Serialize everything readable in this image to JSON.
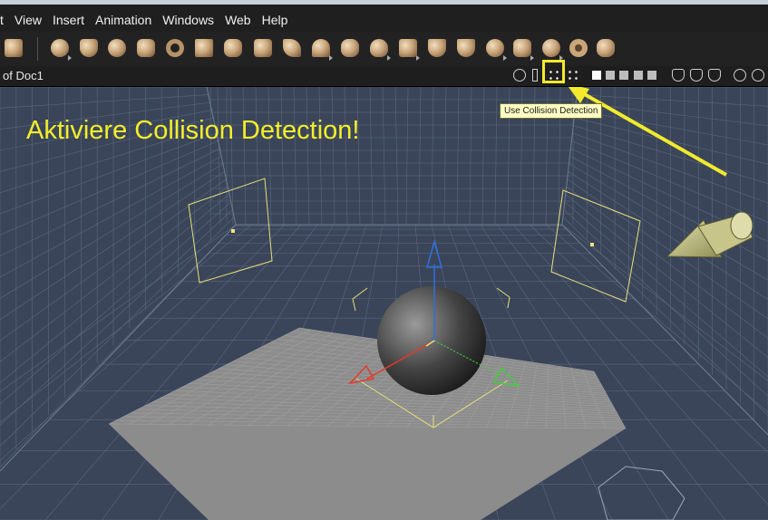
{
  "menubar": {
    "items": [
      "t",
      "View",
      "Insert",
      "Animation",
      "Windows",
      "Web",
      "Help"
    ]
  },
  "toolbar": {
    "icons": [
      "prop-hand-icon",
      "sphere-icon",
      "goblet-icon",
      "globe-icon",
      "figure-icon",
      "torus-icon",
      "text-icon",
      "gem-icon",
      "flower-icon",
      "terrain-icon",
      "tree-icon",
      "cloud-icon",
      "fire-icon",
      "building-icon",
      "grass-icon",
      "bowl-icon",
      "magic-wand-icon",
      "camera-icon",
      "light-icon",
      "target-icon",
      "bone-icon"
    ]
  },
  "document": {
    "title": "of Doc1"
  },
  "tooltip": {
    "text": "Use Collision Detection"
  },
  "annotation": {
    "text": "Aktiviere Collision Detection!",
    "color": "#f4ee2a"
  },
  "colors": {
    "viewport_bg": "#3a4559",
    "grid_line": "#5a6880",
    "floor": "#8c8c8c",
    "highlight": "#f2ea2b",
    "x_axis": "#e23a2a",
    "y_axis": "#2f6fe0",
    "z_axis": "#3fcf3f"
  }
}
